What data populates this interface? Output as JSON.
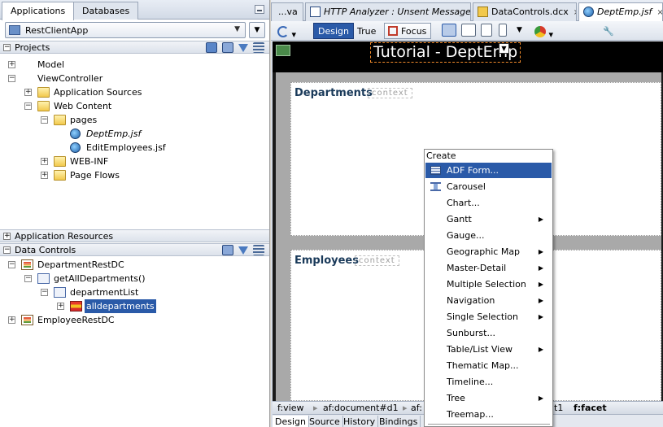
{
  "left": {
    "tabs": [
      "Applications",
      "Databases"
    ],
    "app_selector": "RestClientApp",
    "projects_header": "Projects",
    "projects_tree": [
      {
        "label": "Model",
        "type": "project",
        "level": 0,
        "exp": "+"
      },
      {
        "label": "ViewController",
        "type": "project",
        "level": 0,
        "exp": "-"
      },
      {
        "label": "Application Sources",
        "type": "folder",
        "level": 1,
        "exp": "+"
      },
      {
        "label": "Web Content",
        "type": "folder",
        "level": 1,
        "exp": "-"
      },
      {
        "label": "pages",
        "type": "folder",
        "level": 2,
        "exp": "-"
      },
      {
        "label": "DeptEmp.jsf",
        "type": "jsf",
        "level": 3,
        "exp": "",
        "italic": true
      },
      {
        "label": "EditEmployees.jsf",
        "type": "jsf",
        "level": 3,
        "exp": ""
      },
      {
        "label": "WEB-INF",
        "type": "folder",
        "level": 2,
        "exp": "+"
      },
      {
        "label": "Page Flows",
        "type": "folder",
        "level": 2,
        "exp": "+"
      }
    ],
    "app_resources_header": "Application Resources",
    "data_controls_header": "Data Controls",
    "dc_tree": [
      {
        "label": "DepartmentRestDC",
        "type": "dc",
        "level": 0,
        "exp": "-"
      },
      {
        "label": "getAllDepartments()",
        "type": "meth",
        "level": 1,
        "exp": "-"
      },
      {
        "label": "departmentList",
        "type": "coll",
        "level": 2,
        "exp": "-"
      },
      {
        "label": "alldepartments",
        "type": "attr",
        "level": 3,
        "exp": "+",
        "selected": true
      },
      {
        "label": "EmployeeRestDC",
        "type": "dc",
        "level": 0,
        "exp": "+"
      }
    ]
  },
  "right": {
    "tabs": [
      {
        "label": "...va",
        "icon": "none"
      },
      {
        "label": "HTTP Analyzer : Unsent Message",
        "icon": "http-icon",
        "italic": true
      },
      {
        "label": "DataControls.dcx",
        "icon": "dcx-icon"
      },
      {
        "label": "DeptEmp.jsf",
        "icon": "jsf-icon",
        "italic": true,
        "active": true
      }
    ],
    "toolbar": {
      "design": "Design",
      "true": "True",
      "focus": "Focus"
    },
    "page_title": "Tutorial - DeptEmp",
    "departments_label": "Departments",
    "employees_label": "Employees",
    "context_label": "context",
    "crumbs": [
      "f:view",
      "af:document#d1",
      "af:",
      "t1",
      "f:facet"
    ],
    "bottom_tabs": [
      "Design",
      "Source",
      "History",
      "Bindings"
    ]
  },
  "menu": {
    "header": "Create",
    "items": [
      {
        "label": "ADF Form...",
        "icon": "form-icon",
        "sub": false,
        "hl": true
      },
      {
        "label": "Carousel",
        "icon": "carousel-icon",
        "sub": false
      },
      {
        "label": "Chart...",
        "sub": false
      },
      {
        "label": "Gantt",
        "sub": true
      },
      {
        "label": "Gauge...",
        "sub": false
      },
      {
        "label": "Geographic Map",
        "sub": true
      },
      {
        "label": "Master-Detail",
        "sub": true
      },
      {
        "label": "Multiple Selection",
        "sub": true
      },
      {
        "label": "Navigation",
        "sub": true
      },
      {
        "label": "Single Selection",
        "sub": true
      },
      {
        "label": "Sunburst...",
        "sub": false
      },
      {
        "label": "Table/List View",
        "sub": true
      },
      {
        "label": "Thematic Map...",
        "sub": false
      },
      {
        "label": "Timeline...",
        "sub": false
      },
      {
        "label": "Tree",
        "sub": true
      },
      {
        "label": "Treemap...",
        "sub": false
      }
    ]
  }
}
